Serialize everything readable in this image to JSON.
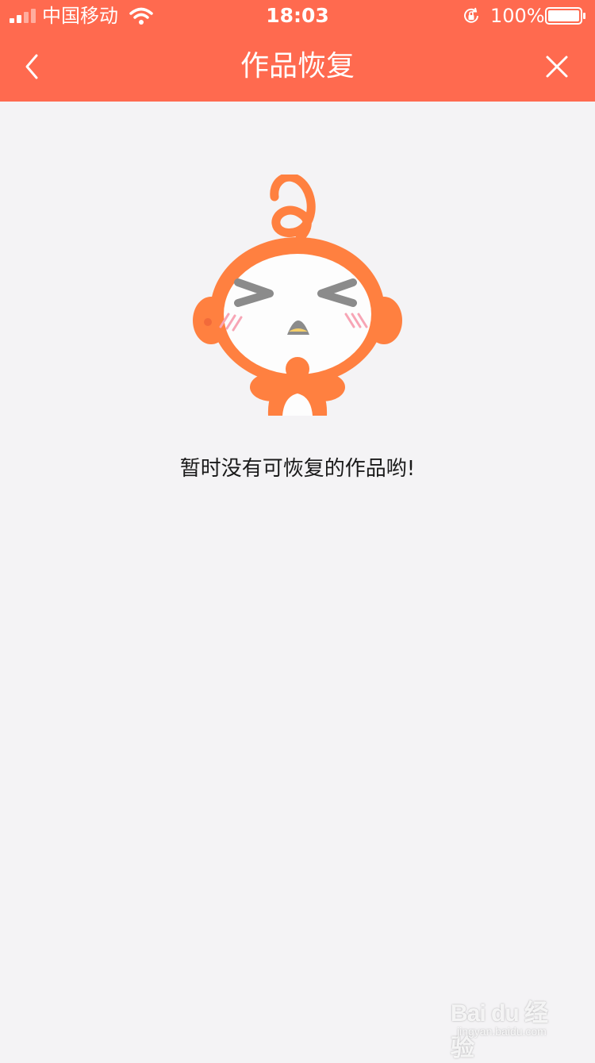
{
  "status_bar": {
    "carrier": "中国移动",
    "time": "18:03",
    "battery": "100%",
    "icons": [
      "signal-icon",
      "wifi-icon",
      "rotation-lock-icon",
      "battery-icon"
    ]
  },
  "nav": {
    "title": "作品恢复",
    "back_icon": "chevron-left-icon",
    "close_icon": "close-icon"
  },
  "empty_state": {
    "message": "暂时没有可恢复的作品哟!",
    "illustration": "mascot-illustration"
  },
  "watermark": {
    "logo": "Bai du 经验",
    "sub": "jingyan.baidu.com"
  },
  "colors": {
    "header": "#ff6a4f",
    "background": "#f4f3f5",
    "mascot": "#ff8040"
  }
}
